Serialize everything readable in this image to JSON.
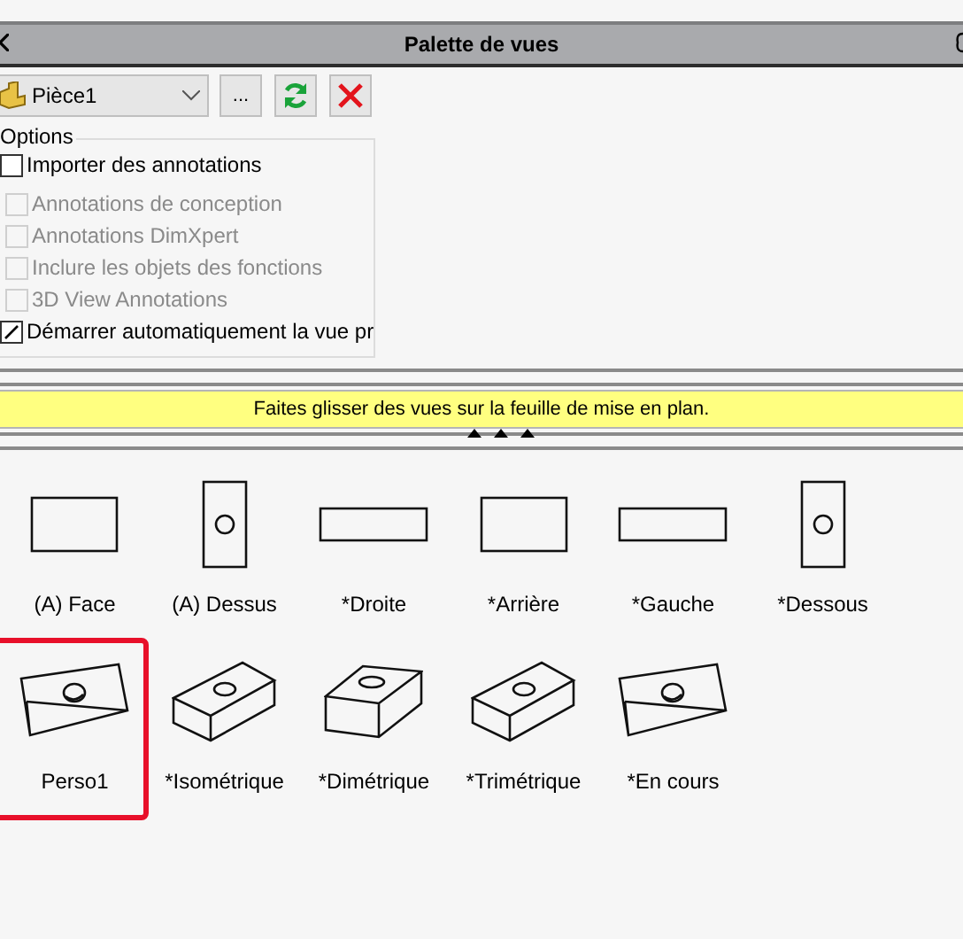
{
  "window": {
    "title": "Palette de vues"
  },
  "toolbar": {
    "part": "Pièce1",
    "browse_label": "..."
  },
  "options": {
    "legend": "Options",
    "items": [
      {
        "label": "Importer des annotations",
        "checked": false,
        "disabled": false
      },
      {
        "label": "Annotations de conception",
        "checked": false,
        "disabled": true
      },
      {
        "label": "Annotations DimXpert",
        "checked": false,
        "disabled": true
      },
      {
        "label": "Inclure les objets des fonctions",
        "checked": false,
        "disabled": true
      },
      {
        "label": "3D View Annotations",
        "checked": false,
        "disabled": true
      },
      {
        "label": "Démarrer automatiquement la vue pr",
        "checked": true,
        "disabled": false
      }
    ]
  },
  "hint": "Faites glisser des vues sur la feuille de mise en plan.",
  "views": [
    {
      "label": "(A) Face",
      "kind": "wide",
      "highlighted": false
    },
    {
      "label": "(A) Dessus",
      "kind": "tall",
      "highlighted": false
    },
    {
      "label": "*Droite",
      "kind": "slab",
      "highlighted": false
    },
    {
      "label": "*Arrière",
      "kind": "wide",
      "highlighted": false
    },
    {
      "label": "*Gauche",
      "kind": "slab",
      "highlighted": false
    },
    {
      "label": "*Dessous",
      "kind": "tall",
      "highlighted": false
    },
    {
      "label": "Perso1",
      "kind": "tilted",
      "highlighted": true
    },
    {
      "label": "*Isométrique",
      "kind": "iso",
      "highlighted": false
    },
    {
      "label": "*Dimétrique",
      "kind": "dimetric",
      "highlighted": false
    },
    {
      "label": "*Trimétrique",
      "kind": "iso",
      "highlighted": false
    },
    {
      "label": "*En cours",
      "kind": "tilted",
      "highlighted": false
    }
  ]
}
